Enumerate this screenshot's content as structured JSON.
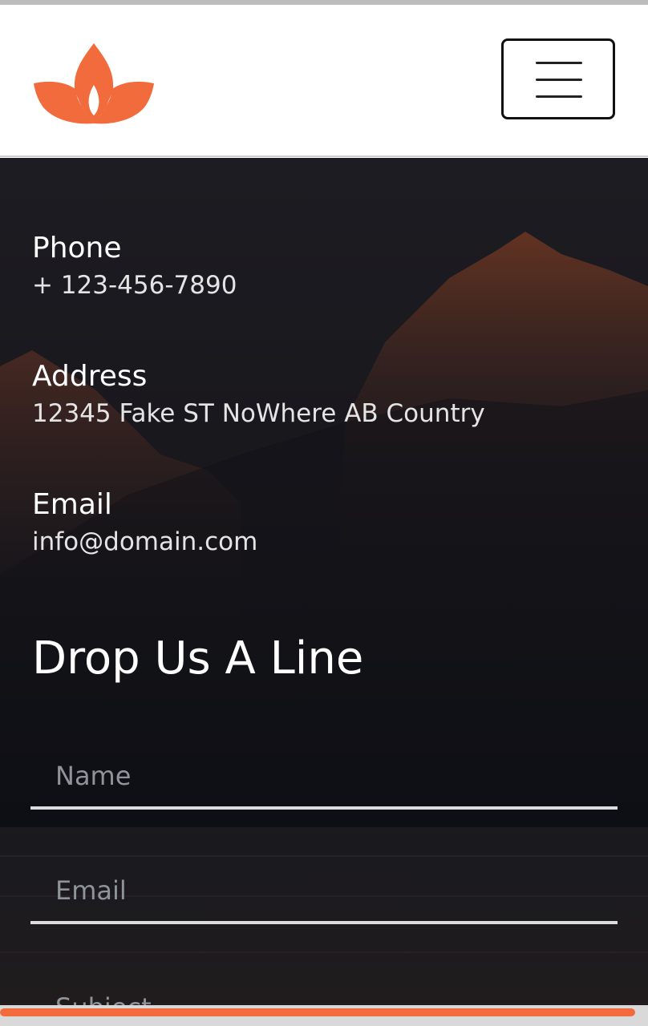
{
  "brand": {
    "logo_icon": "lotus-logo-icon",
    "accent_color": "#f26b3c"
  },
  "header": {
    "menu_icon": "hamburger-menu-icon"
  },
  "contact": {
    "phone_label": "Phone",
    "phone_value": "+ 123-456-7890",
    "address_label": "Address",
    "address_value": "12345 Fake ST NoWhere AB Country",
    "email_label": "Email",
    "email_value": "info@domain.com"
  },
  "form": {
    "heading": "Drop Us A Line",
    "name_placeholder": "Name",
    "email_placeholder": "Email",
    "subject_placeholder": "Subject"
  },
  "scroll_progress": 0.98
}
